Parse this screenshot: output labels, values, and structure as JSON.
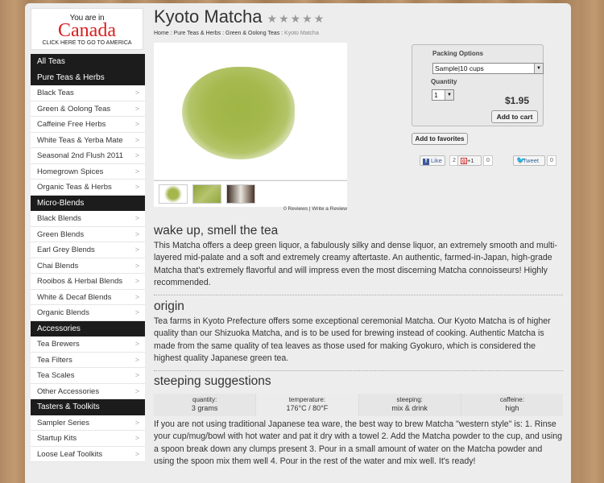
{
  "country": {
    "line1": "You are in",
    "line2": "Canada",
    "line3": "CLICK HERE TO GO TO AMERICA"
  },
  "sidebar": {
    "sections": [
      {
        "heading": "All Teas",
        "items": []
      },
      {
        "heading": "Pure Teas & Herbs",
        "items": [
          "Black Teas",
          "Green & Oolong Teas",
          "Caffeine Free Herbs",
          "White Teas & Yerba Mate",
          "Seasonal 2nd Flush 2011",
          "Homegrown Spices",
          "Organic Teas & Herbs"
        ]
      },
      {
        "heading": "Micro-Blends",
        "items": [
          "Black Blends",
          "Green Blends",
          "Earl Grey Blends",
          "Chai Blends",
          "Rooibos & Herbal Blends",
          "White & Decaf Blends",
          "Organic Blends"
        ]
      },
      {
        "heading": "Accessories",
        "items": [
          "Tea Brewers",
          "Tea Filters",
          "Tea Scales",
          "Other Accessories"
        ]
      },
      {
        "heading": "Tasters & Toolkits",
        "items": [
          "Sampler Series",
          "Startup Kits",
          "Loose Leaf Toolkits"
        ]
      }
    ],
    "chevron": ">"
  },
  "product": {
    "title": "Kyoto Matcha",
    "stars": "★★★★★",
    "breadcrumb": [
      "Home",
      "Pure Teas & Herbs",
      "Green & Oolong Teas",
      "Kyoto Matcha"
    ],
    "reviews": "0 Reviews | Write a Review"
  },
  "buybox": {
    "packing_label": "Packing Options",
    "packing_value": "Sample|10 cups",
    "quantity_label": "Quantity",
    "quantity_value": "1",
    "price": "$1.95",
    "add_to_cart": "Add to cart",
    "add_to_favorites": "Add to favorites"
  },
  "social": {
    "like": "Like",
    "like_count": "2",
    "plus": "+1",
    "plus_count": "0",
    "tweet": "Tweet",
    "tweet_count": "0"
  },
  "sections": {
    "wake_title": "wake up, smell the tea",
    "wake_body": "This Matcha offers a deep green liquor, a fabulously silky and dense liquor, an extremely smooth and multi-layered mid-palate and a soft and extremely creamy aftertaste. An authentic, farmed-in-Japan, high-grade Matcha that's extremely flavorful and will impress even the most discerning Matcha connoisseurs! Highly recommended.",
    "origin_title": "origin",
    "origin_body": "Tea farms in Kyoto Prefecture offers some exceptional ceremonial Matcha. Our Kyoto Matcha is of higher quality than our Shizuoka Matcha, and is to be used for brewing instead of cooking. Authentic Matcha is made from the same quality of tea leaves as those used for making Gyokuro, which is considered the highest quality Japanese green tea.",
    "steep_title": "steeping suggestions",
    "steep_body": "If you are not using traditional Japanese tea ware, the best way to brew Matcha \"western style\" is: 1. Rinse your cup/mug/bowl with hot water and pat it dry with a towel 2. Add the Matcha powder to the cup, and using a spoon break down any clumps present 3. Pour in a small amount of water on the Matcha powder and using the spoon mix them well 4. Pour in the rest of the water and mix well. It's ready!"
  },
  "steeping": [
    {
      "label": "quantity:",
      "value": "3 grams"
    },
    {
      "label": "temperature:",
      "value": "176°C / 80°F"
    },
    {
      "label": "steeping:",
      "value": "mix & drink"
    },
    {
      "label": "caffeine:",
      "value": "high"
    }
  ]
}
